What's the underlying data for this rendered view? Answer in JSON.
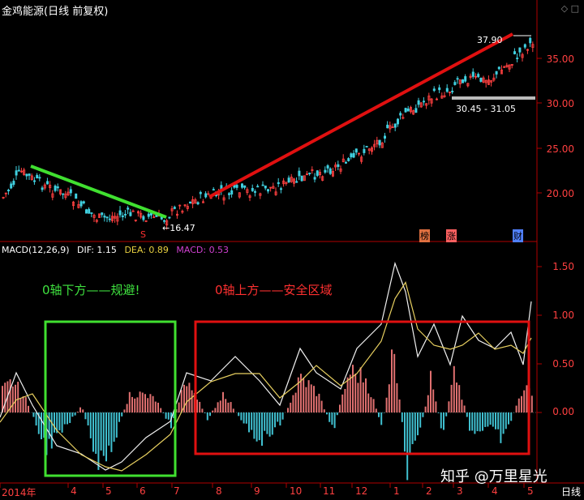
{
  "window": {
    "title": "金鸡能源(日线 前复权)",
    "controls": [
      "◇",
      "□"
    ]
  },
  "price_panel": {
    "y_ticks": [
      "35.00",
      "30.00",
      "25.00",
      "20.00"
    ],
    "annotations": {
      "high": "37.90",
      "low": "←16.47",
      "range": "30.45 - 31.05"
    },
    "event_markers": [
      {
        "label": "S",
        "color": "#ff3030"
      },
      {
        "label": "榜",
        "color": "#e07040"
      },
      {
        "label": "涨",
        "color": "#ff6060"
      },
      {
        "label": "财",
        "color": "#5080ff"
      }
    ]
  },
  "macd_panel": {
    "legend": {
      "name": "MACD(12,26,9)",
      "dif": "DIF: 1.15",
      "dea": "DEA: 0.89",
      "macd": "MACD: 0.53"
    },
    "legend_colors": {
      "name": "#ffffff",
      "dif": "#ffffff",
      "dea": "#e8d040",
      "macd": "#d040d0"
    },
    "y_ticks": [
      "1.50",
      "1.00",
      "0.50",
      "0.00"
    ],
    "notes": {
      "below_zero": "0轴下方——规避!",
      "above_zero": "0轴上方——安全区域"
    }
  },
  "time_axis": {
    "labels": [
      "2014年",
      "4",
      "5",
      "6",
      "7",
      "8",
      "9",
      "10",
      "11",
      "12",
      "1",
      "2",
      "3",
      "4",
      "5"
    ],
    "period_tab": "日线"
  },
  "watermark": "知乎 @万里星光",
  "colors": {
    "up_candle": "#ff4040",
    "down_candle": "#40d0e0",
    "trend_green": "#40e030",
    "trend_red": "#e01010",
    "axis": "#b00000",
    "dif_line": "#f0f0f0",
    "dea_line": "#e8d060",
    "hist_pos": "#e07070",
    "hist_neg": "#40c0d0"
  }
}
